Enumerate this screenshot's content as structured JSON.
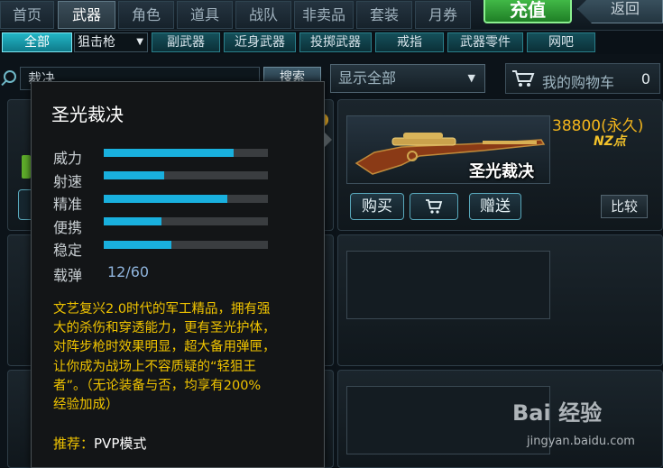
{
  "top_tabs": [
    {
      "label": "首页",
      "active": false
    },
    {
      "label": "武器",
      "active": true
    },
    {
      "label": "角色",
      "active": false
    },
    {
      "label": "道具",
      "active": false
    },
    {
      "label": "战队",
      "active": false
    },
    {
      "label": "非卖品",
      "active": false
    },
    {
      "label": "套装",
      "active": false
    },
    {
      "label": "月券",
      "active": false
    }
  ],
  "recharge_label": "充值",
  "back_label": "返回",
  "sub_tabs": [
    {
      "label": "全部",
      "active": true
    },
    {
      "label": "副武器",
      "active": false
    },
    {
      "label": "近身武器",
      "active": false
    },
    {
      "label": "投掷武器",
      "active": false
    },
    {
      "label": "戒指",
      "active": false
    },
    {
      "label": "武器零件",
      "active": false
    },
    {
      "label": "网吧",
      "active": false
    }
  ],
  "sub_select": {
    "value": "狙击枪"
  },
  "search": {
    "value": "裁决",
    "button_label": "搜索"
  },
  "filter": {
    "value": "显示全部"
  },
  "cart": {
    "label": "我的购物车",
    "count": "0"
  },
  "item": {
    "name": "圣光裁决",
    "price": "38800(永久)",
    "currency": "NZ点",
    "buy_label": "购买",
    "gift_label": "赠送",
    "compare_label": "比较"
  },
  "tooltip": {
    "title": "圣光裁决",
    "stats": [
      {
        "label": "威力",
        "value": 0.79
      },
      {
        "label": "射速",
        "value": 0.37
      },
      {
        "label": "精准",
        "value": 0.75
      },
      {
        "label": "便携",
        "value": 0.35
      },
      {
        "label": "稳定",
        "value": 0.41
      }
    ],
    "ammo_label": "载弹",
    "ammo_value": "12/60",
    "description_lines": [
      "文艺复兴2.0时代的军工精品，拥有强",
      "大的杀伤和穿透能力，更有圣光护体，",
      "对阵步枪时效果明显，超大备用弹匣，",
      "让你成为战场上不容质疑的“轻狙王",
      "者”。（无论装备与否，均享有200%",
      "经验加成）"
    ],
    "recommend_label": "推荐：",
    "recommend_value": "PVP模式"
  },
  "watermark": {
    "text": "Bai 经验",
    "site": "jingyan.baidu.com"
  },
  "colors": {
    "accent": "#19b0de",
    "price": "#f3b51c",
    "description": "#f0c400",
    "recharge": "#47c24c"
  }
}
